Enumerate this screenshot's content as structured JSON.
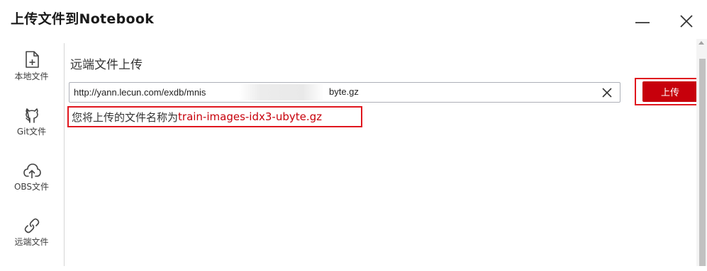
{
  "dialog": {
    "title": "上传文件到Notebook"
  },
  "sidebar": {
    "items": [
      {
        "label": "本地文件",
        "icon": "file-plus-icon"
      },
      {
        "label": "Git文件",
        "icon": "github-icon"
      },
      {
        "label": "OBS文件",
        "icon": "cloud-upload-icon"
      },
      {
        "label": "远端文件",
        "icon": "link-icon"
      }
    ]
  },
  "main": {
    "section_title": "远端文件上传",
    "url": {
      "value": "http://yann.lecun.com/exdb/mnis",
      "tail": "byte.gz"
    },
    "upload_label": "上传",
    "filename_prefix": "您将上传的文件名称为",
    "filename": "train-images-idx3-ubyte.gz"
  },
  "colors": {
    "accent": "#c7000b",
    "highlight_border": "#e0161e"
  }
}
